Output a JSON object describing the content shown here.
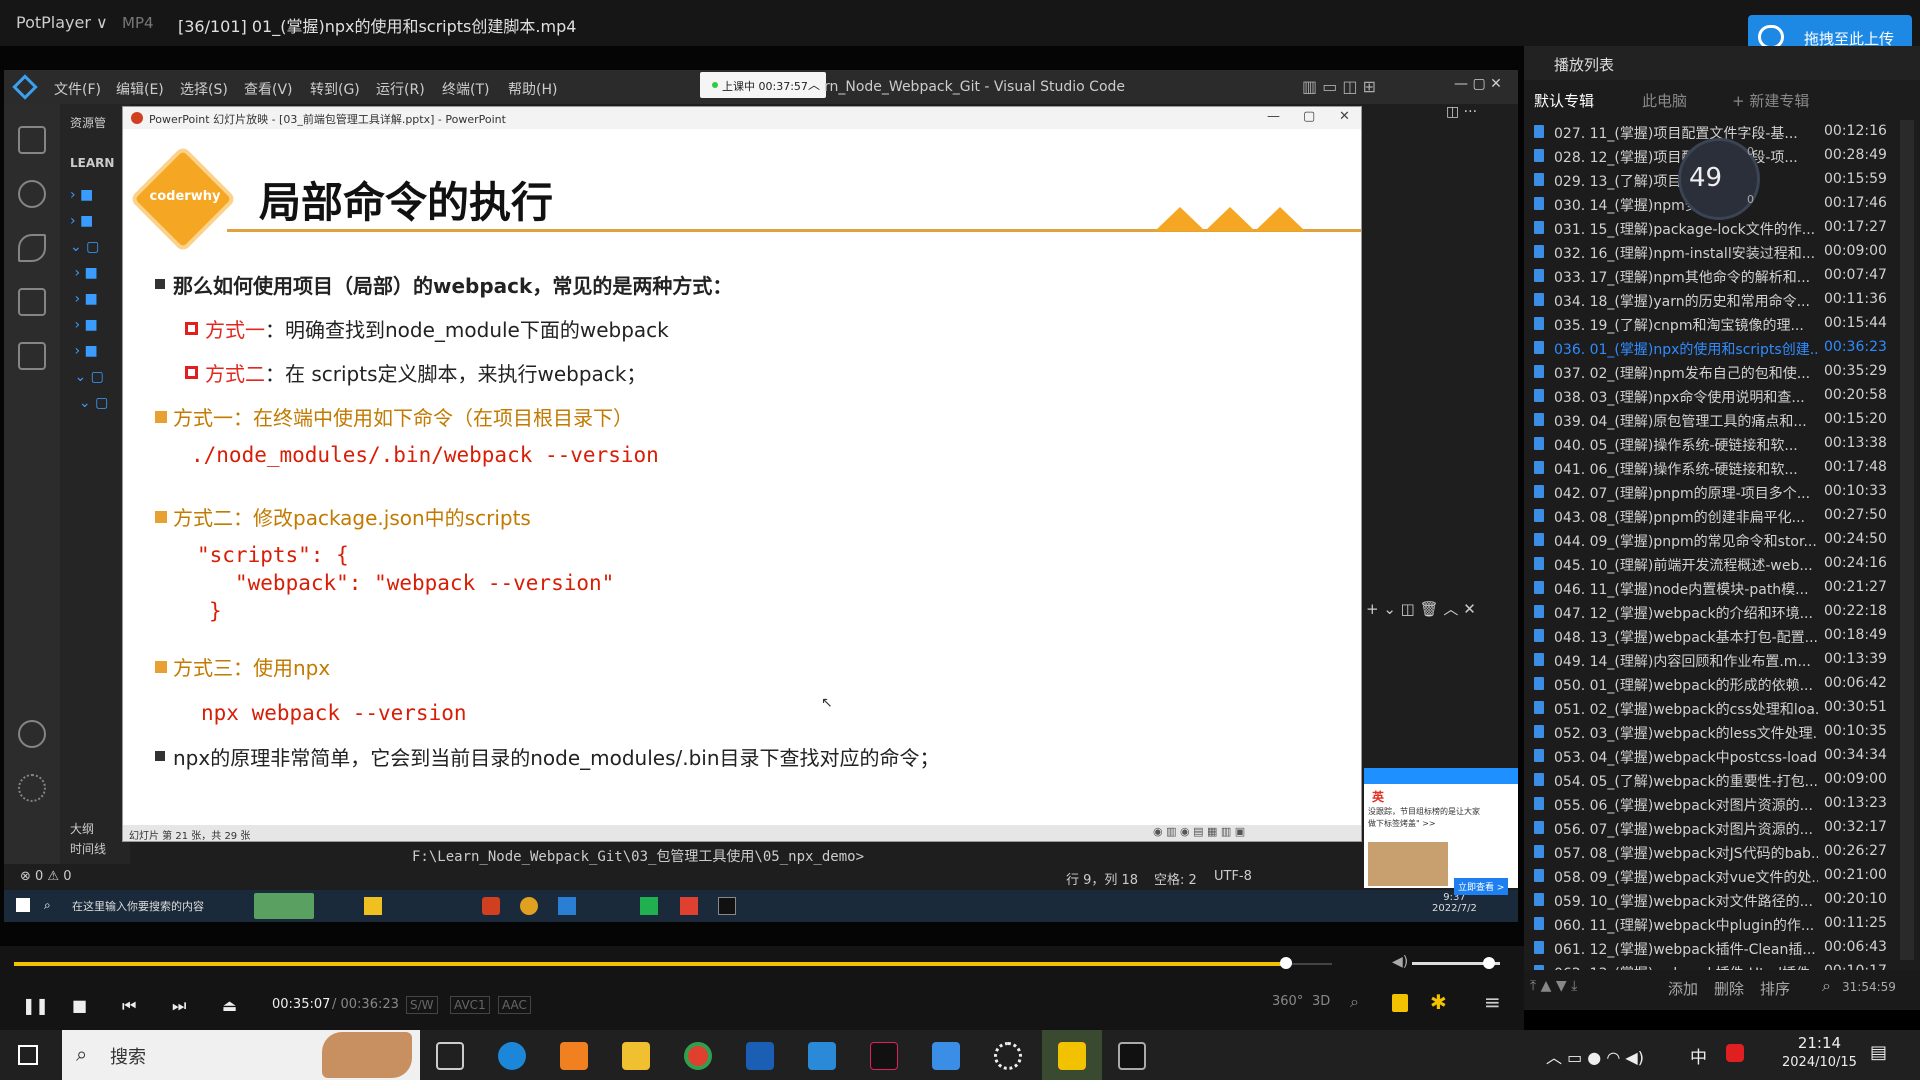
{
  "player": {
    "app_name": "PotPlayer ∨",
    "format": "MP4",
    "title": "[36/101] 01_(掌握)npx的使用和scripts创建脚本.mp4",
    "upload_label": "拖拽至此上传",
    "current_time": "00:35:07",
    "total_time": "/ 00:36:23",
    "tags": [
      "S/W",
      "AVC1",
      "AAC"
    ],
    "right_tags": [
      "360°",
      "3D"
    ]
  },
  "vscode": {
    "menus": [
      "文件(F)",
      "编辑(E)",
      "选择(S)",
      "查看(V)",
      "转到(G)",
      "运行(R)",
      "终端(T)",
      "帮助(H)"
    ],
    "title": "rn_Node_Webpack_Git - Visual Studio Code",
    "recording": "上课中 00:37:57",
    "explorer_header": "资源管",
    "project": "LEARN",
    "outline": "大纲",
    "timeline": "时间线",
    "terminal_path": "F:\\Learn_Node_Webpack_Git\\03_包管理工具使用\\05_npx_demo>",
    "status_errors": "⊗ 0 ⚠ 0",
    "status_pos": "行 9，列 18",
    "status_spaces": "空格: 2",
    "status_enc": "UTF-8"
  },
  "ppt": {
    "window_title": "PowerPoint 幻灯片放映 - [03_前端包管理工具详解.pptx] - PowerPoint",
    "status": "幻灯片 第 21 张，共 29 张",
    "badge": "coderwhy",
    "slide_title": "局部命令的执行",
    "line1": "那么如何使用项目（局部）的webpack，常见的是两种方式：",
    "opt1_label": "方式一",
    "opt1_text": "：明确查找到node_module下面的webpack",
    "opt2_label": "方式二",
    "opt2_text": "：在 scripts定义脚本，来执行webpack；",
    "sec1": "方式一：在终端中使用如下命令（在项目根目录下）",
    "code1": "./node_modules/.bin/webpack --version",
    "sec2": "方式二：修改package.json中的scripts",
    "code2a": "\"scripts\": {",
    "code2b": "\"webpack\": \"webpack --version\"",
    "code2c": "}",
    "sec3": "方式三：使用npx",
    "code3": "npx webpack --version",
    "line_last": "npx的原理非常简单，它会到当前目录的node_modules/.bin目录下查找对应的命令；"
  },
  "playlist": {
    "header": "播放列表",
    "tabs": [
      "默认专辑",
      "此电脑",
      "+ 新建专辑"
    ],
    "speed_pct": "49",
    "speed_up": "0",
    "speed_down": "0",
    "items": [
      {
        "t": "027. 11_(掌握)项目配置文件字段-基...",
        "d": "00:12:16"
      },
      {
        "t": "028. 12_(掌握)项目配置文件字段-项...",
        "d": "00:28:49"
      },
      {
        "t": "029. 13_(了解)项目配置...",
        "d": "00:15:59"
      },
      {
        "t": "030. 14_(掌握)npm安装...",
        "d": "00:17:46"
      },
      {
        "t": "031. 15_(理解)package-lock文件的作...",
        "d": "00:17:27"
      },
      {
        "t": "032. 16_(理解)npm-install安装过程和...",
        "d": "00:09:00"
      },
      {
        "t": "033. 17_(理解)npm其他命令的解析和...",
        "d": "00:07:47"
      },
      {
        "t": "034. 18_(掌握)yarn的历史和常用命令...",
        "d": "00:11:36"
      },
      {
        "t": "035. 19_(了解)cnpm和淘宝镜像的理...",
        "d": "00:15:44"
      },
      {
        "t": "036. 01_(掌握)npx的使用和scripts创建...",
        "d": "00:36:23"
      },
      {
        "t": "037. 02_(理解)npm发布自己的包和使...",
        "d": "00:35:29"
      },
      {
        "t": "038. 03_(理解)npx命令使用说明和查...",
        "d": "00:20:58"
      },
      {
        "t": "039. 04_(理解)原包管理工具的痛点和...",
        "d": "00:15:20"
      },
      {
        "t": "040. 05_(理解)操作系统-硬链接和软...",
        "d": "00:13:38"
      },
      {
        "t": "041. 06_(理解)操作系统-硬链接和软...",
        "d": "00:17:48"
      },
      {
        "t": "042. 07_(理解)pnpm的原理-项目多个...",
        "d": "00:10:33"
      },
      {
        "t": "043. 08_(理解)pnpm的创建非扁平化...",
        "d": "00:27:50"
      },
      {
        "t": "044. 09_(掌握)pnpm的常见命令和stor...",
        "d": "00:24:50"
      },
      {
        "t": "045. 10_(理解)前端开发流程概述-web...",
        "d": "00:24:16"
      },
      {
        "t": "046. 11_(掌握)node内置模块-path模...",
        "d": "00:21:27"
      },
      {
        "t": "047. 12_(掌握)webpack的介绍和环境...",
        "d": "00:22:18"
      },
      {
        "t": "048. 13_(掌握)webpack基本打包-配置...",
        "d": "00:18:49"
      },
      {
        "t": "049. 14_(理解)内容回顾和作业布置.m...",
        "d": "00:13:39"
      },
      {
        "t": "050. 01_(理解)webpack的形成的依赖...",
        "d": "00:06:42"
      },
      {
        "t": "051. 02_(掌握)webpack的css处理和loa...",
        "d": "00:30:51"
      },
      {
        "t": "052. 03_(掌握)webpack的less文件处理...",
        "d": "00:10:35"
      },
      {
        "t": "053. 04_(掌握)webpack中postcss-load...",
        "d": "00:34:34"
      },
      {
        "t": "054. 05_(了解)webpack的重要性-打包...",
        "d": "00:09:00"
      },
      {
        "t": "055. 06_(掌握)webpack对图片资源的...",
        "d": "00:13:23"
      },
      {
        "t": "056. 07_(掌握)webpack对图片资源的...",
        "d": "00:32:17"
      },
      {
        "t": "057. 08_(掌握)webpack对JS代码的bab...",
        "d": "00:26:27"
      },
      {
        "t": "058. 09_(掌握)webpack对vue文件的处...",
        "d": "00:21:00"
      },
      {
        "t": "059. 10_(掌握)webpack对文件路径的...",
        "d": "00:20:10"
      },
      {
        "t": "060. 11_(理解)webpack中plugin的作...",
        "d": "00:11:25"
      },
      {
        "t": "061. 12_(掌握)webpack插件-Clean插...",
        "d": "00:06:43"
      },
      {
        "t": "062. 13_(掌握)webpack插件-Html插件...",
        "d": "00:10:17"
      }
    ],
    "active_index": 9,
    "bottom_buttons": [
      "添加",
      "删除",
      "排序"
    ],
    "total": "31:54:59"
  },
  "seek": {
    "progress": 0.965,
    "volume": 0.88
  },
  "inner_taskbar": {
    "search": "在这里输入你要搜索的内容",
    "time": "9:37",
    "date": "2022/7/2"
  },
  "ad": {
    "line1": "英",
    "line2": "没跟踪，节目组标榜的是让大家",
    "line3": "做下标签烤盖\" >>",
    "cta": "立即查看 >"
  },
  "taskbar": {
    "search": "搜索",
    "time": "21:14",
    "date": "2024/10/15",
    "ime": "中"
  },
  "colors": {
    "accent": "#f2c200",
    "playlist_active": "#2f8cff",
    "slide_accent": "#e0a23c"
  }
}
